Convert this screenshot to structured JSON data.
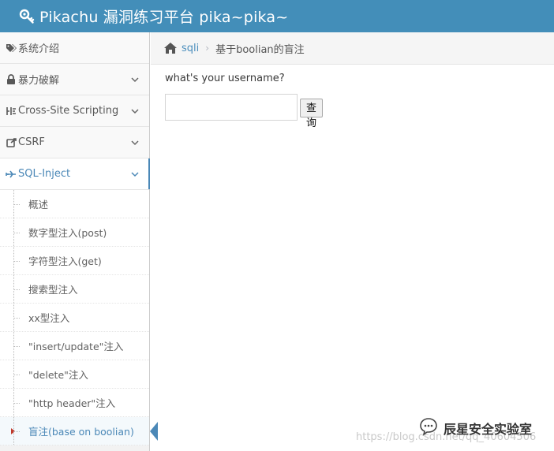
{
  "header": {
    "title": "Pikachu 漏洞练习平台 pika~pika~",
    "icon": "key-icon",
    "bg_color": "#438eb9"
  },
  "sidebar": {
    "items": [
      {
        "label": "系统介绍",
        "icon": "tags-icon",
        "has_chevron": false
      },
      {
        "label": "暴力破解",
        "icon": "lock-icon",
        "has_chevron": true
      },
      {
        "label": "Cross-Site Scripting",
        "icon": "code-icon",
        "has_chevron": true
      },
      {
        "label": "CSRF",
        "icon": "share-icon",
        "has_chevron": true
      },
      {
        "label": "SQL-Inject",
        "icon": "plane-icon",
        "has_chevron": true,
        "open": true
      }
    ],
    "submenu": [
      {
        "label": "概述"
      },
      {
        "label": "数字型注入(post)"
      },
      {
        "label": "字符型注入(get)"
      },
      {
        "label": "搜索型注入"
      },
      {
        "label": "xx型注入"
      },
      {
        "label": "\"insert/update\"注入"
      },
      {
        "label": "\"delete\"注入"
      },
      {
        "label": "\"http header\"注入"
      },
      {
        "label": "盲注(base on boolian)",
        "active": true
      }
    ],
    "accent_color": "#4b88b7"
  },
  "breadcrumb": {
    "link": "sqli",
    "current": "基于boolian的盲注"
  },
  "main": {
    "prompt": "what's your username?",
    "input_value": "",
    "submit_label": "查询"
  },
  "watermark": {
    "brand": "辰星安全实验室",
    "url": "https://blog.csdn.net/qq_40604506"
  }
}
